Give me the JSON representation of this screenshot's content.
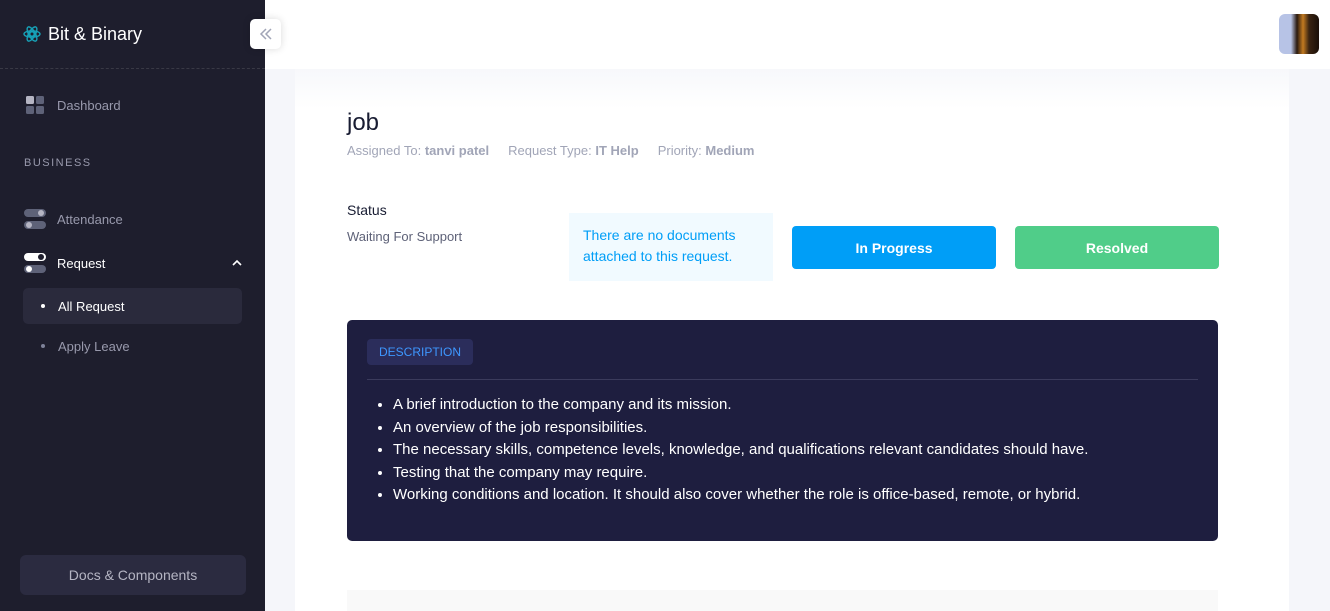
{
  "brand": {
    "name": "Bit & Binary"
  },
  "sidebar": {
    "dashboard_label": "Dashboard",
    "section_title": "BUSINESS",
    "attendance_label": "Attendance",
    "request_label": "Request",
    "sub_items": [
      {
        "label": "All Request",
        "active": true
      },
      {
        "label": "Apply Leave",
        "active": false
      }
    ],
    "docs_label": "Docs & Components"
  },
  "request": {
    "title": "job",
    "assigned_to_label": "Assigned To:",
    "assigned_to": "tanvi patel",
    "type_label": "Request Type:",
    "type": "IT Help",
    "priority_label": "Priority:",
    "priority": "Medium",
    "status_label": "Status",
    "status_value": "Waiting For Support",
    "doc_note": "There are no documents attached to this request.",
    "in_progress_label": "In Progress",
    "resolved_label": "Resolved"
  },
  "description": {
    "badge": "DESCRIPTION",
    "items": [
      "A brief introduction to the company and its mission.",
      "An overview of the job responsibilities.",
      "The necessary skills, competence levels, knowledge, and qualifications relevant candidates should have.",
      "Testing that the company may require.",
      "Working conditions and location. It should also cover whether the role is office-based, remote, or hybrid."
    ]
  },
  "colors": {
    "sidebar_bg": "#1e1e2d",
    "primary": "#009ef7",
    "success": "#50cd89",
    "description_bg": "#1e1e3f"
  }
}
